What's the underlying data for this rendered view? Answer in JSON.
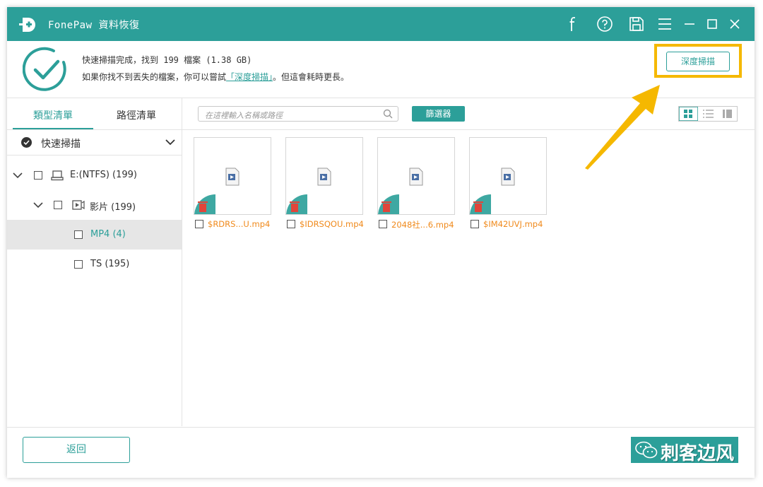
{
  "window": {
    "app_name": "FonePaw",
    "app_title": "資料恢復",
    "title_icons": [
      "facebook-icon",
      "help-icon",
      "save-icon",
      "menu-icon",
      "minimize-icon",
      "maximize-icon",
      "close-icon"
    ]
  },
  "status": {
    "line1": "快速掃描完成，找到 199 檔案 (1.38 GB)",
    "line2_pre": "如果你找不到丟失的檔案，你可以嘗試",
    "line2_link": "「深度掃描」",
    "line2_post": "。但這會耗時更長。",
    "deep_scan_button": "深度掃描"
  },
  "left_panel": {
    "tabs": [
      {
        "label": "類型清單",
        "active": true
      },
      {
        "label": "路徑清單",
        "active": false
      }
    ],
    "scan_mode": "快速掃描",
    "tree": [
      {
        "label": "E:(NTFS) (199)",
        "expanded": true,
        "checked": false
      },
      {
        "label": "影片 (199)",
        "expanded": true,
        "checked": false
      },
      {
        "label": "MP4 (4)",
        "selected": true,
        "checked": false
      },
      {
        "label": "TS (195)",
        "selected": false,
        "checked": false
      }
    ]
  },
  "toolbar": {
    "search_placeholder": "在這裡輸入名稱或路徑",
    "filter_button": "篩選器",
    "view_modes": [
      "grid",
      "list",
      "detail"
    ],
    "active_view": "grid"
  },
  "files": [
    {
      "name": "$RDRS...U.mp4",
      "deleted": true
    },
    {
      "name": "$IDRSQOU.mp4",
      "deleted": true
    },
    {
      "name": "2048社...6.mp4",
      "deleted": true
    },
    {
      "name": "$IM42UVJ.mp4",
      "deleted": true
    }
  ],
  "footer": {
    "back_button": "返回",
    "watermark": "刺客边风"
  },
  "colors": {
    "accent": "#2c9f99",
    "highlight": "#f5b800",
    "file_name": "#f08a1c",
    "deleted_icon": "#e0453a"
  }
}
